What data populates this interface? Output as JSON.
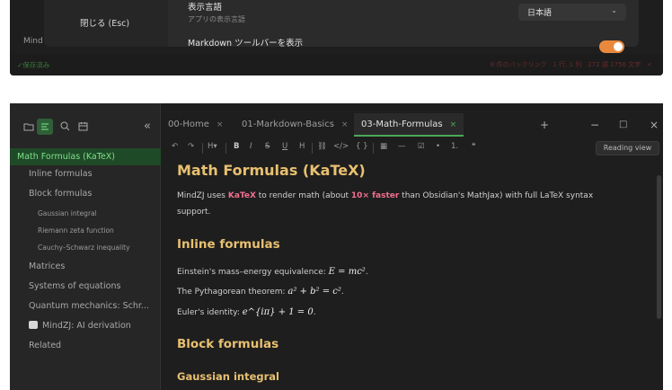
{
  "top_window": {
    "close_button": "閉じる (Esc)",
    "setting_label": "表示言語",
    "setting_desc": "アプリの表示言語",
    "language_value": "日本語",
    "markdown_toolbar_label": "Markdown ツールバーを表示",
    "sidebar_cut_text": "Mind",
    "status_saved": "✓保存済み",
    "status_right": "8 件のバックリンク　1 行, 1 列　272 語 1756 文字　<"
  },
  "sidebar": {
    "items": [
      {
        "label": "Math Formulas (KaTeX)",
        "active": true
      },
      {
        "label": "Inline formulas"
      },
      {
        "label": "Block formulas"
      },
      {
        "label": "Gaussian integral",
        "sub": true
      },
      {
        "label": "Riemann zeta function",
        "sub": true
      },
      {
        "label": "Cauchy–Schwarz inequality",
        "sub": true
      },
      {
        "label": "Matrices"
      },
      {
        "label": "Systems of equations"
      },
      {
        "label": "Quantum mechanics: Schr..."
      },
      {
        "label": "MindZJ: AI derivation"
      },
      {
        "label": "Related"
      }
    ],
    "collapse_glyph": "«"
  },
  "tabs": [
    {
      "label": "00-Home",
      "close": "×"
    },
    {
      "label": "01-Markdown-Basics",
      "close": "×"
    },
    {
      "label": "03-Math-Formulas",
      "close": "×",
      "active": true
    }
  ],
  "tab_add": "+",
  "window_controls": {
    "minimize": "−",
    "maximize": "□",
    "close": "×"
  },
  "toolbar": {
    "undo": "↶",
    "redo": "↷",
    "heading": "H▾",
    "bold": "B",
    "italic": "I",
    "strike": "S",
    "underline": "U",
    "highlight": "H",
    "link": "⛓",
    "code": "</>",
    "math": "{ }",
    "table": "▦",
    "hr": "—",
    "checklist": "☑",
    "bullet": "•",
    "numbered": "1.",
    "quote": "❝",
    "reading_view": "Reading view"
  },
  "content": {
    "title": "Math Formulas (KaTeX)",
    "intro_before": "MindZJ uses ",
    "intro_katex": "KaTeX",
    "intro_middle": " to render math (about ",
    "intro_faster": "10× faster",
    "intro_after": " than Obsidian's MathJax) with full LaTeX syntax",
    "intro_line2": "support.",
    "inline_heading": "Inline formulas",
    "einstein_text": "Einstein's mass–energy equivalence: ",
    "einstein_math": "E = mc²",
    "einstein_end": ".",
    "pythag_text": "The Pythagorean theorem: ",
    "pythag_math": "a² + b² = c²",
    "pythag_end": ".",
    "euler_text": "Euler's identity: ",
    "euler_math": "e^{iπ} + 1 = 0",
    "euler_end": ".",
    "block_heading": "Block formulas",
    "gaussian_heading": "Gaussian integral"
  },
  "colors": {
    "accent_green": "#4ca85a",
    "heading": "#e8c070",
    "highlight": "#f07090",
    "toggle": "#e8893e"
  }
}
